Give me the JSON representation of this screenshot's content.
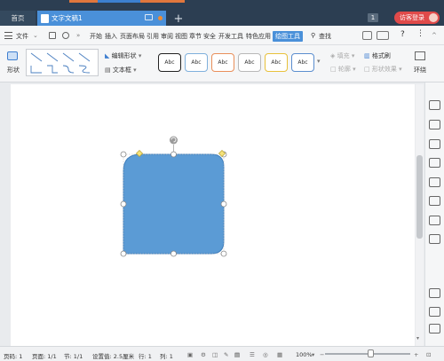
{
  "titlebar": {
    "home_tab": "首页",
    "doc_tab": "文字文稿1",
    "new_tab": "+",
    "window_count": "1",
    "login_button": "访客登录"
  },
  "menubar": {
    "file_menu": "文件",
    "tabs": [
      "开始",
      "插入",
      "页面布局",
      "引用",
      "审阅",
      "视图",
      "章节",
      "安全",
      "开发工具",
      "特色应用",
      "绘图工具"
    ],
    "active_tab": "绘图工具",
    "search": "查找",
    "help": "?"
  },
  "ribbon": {
    "shape_button": "形状",
    "edit_shape": "编辑形状",
    "textbox": "文本框",
    "styles": [
      "Abc",
      "Abc",
      "Abc",
      "Abc",
      "Abc",
      "Abc"
    ],
    "style_border_colors": [
      "#222222",
      "#7fb0dc",
      "#e98f5a",
      "#b8b8b8",
      "#e8c13b",
      "#5b8ecf"
    ],
    "fill": "填充",
    "outline": "轮廓",
    "format_brush": "格式刷",
    "shape_effect": "形状效果",
    "wrap": "环绕"
  },
  "shape": {
    "fill_color": "#5b9bd5",
    "stroke_color": "#3f7fbd",
    "type": "snip-round-rectangle"
  },
  "statusbar": {
    "page_num": "页码: 1",
    "page": "页面: 1/1",
    "section": "节: 1/1",
    "setting": "设置值: 2.5厘米",
    "row": "行: 1",
    "col": "列: 1",
    "zoom": "100%"
  },
  "colors": {
    "titlebar": "#2c3e52",
    "accent": "#4a90d9",
    "login": "#e04a4a"
  }
}
